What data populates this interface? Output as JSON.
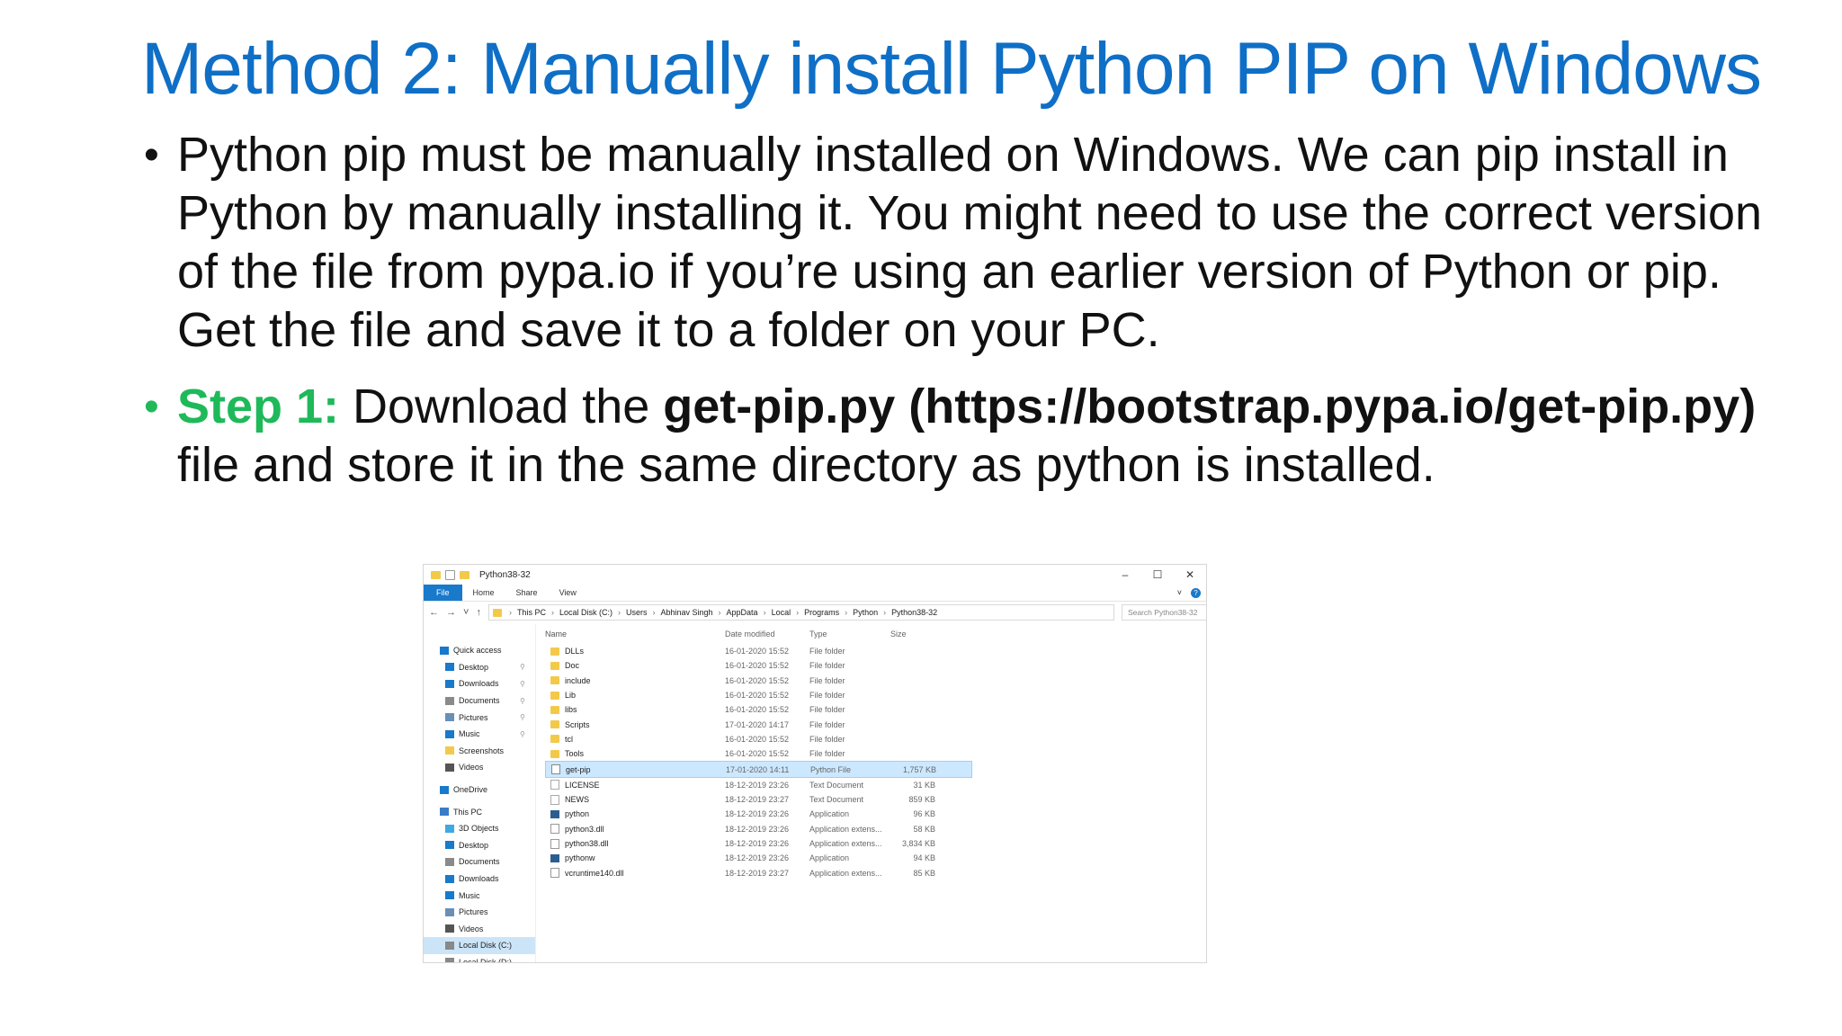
{
  "slide": {
    "title": "Method 2: Manually install Python PIP on Windows",
    "bullet1": "Python pip must be manually installed on Windows. We can pip install in Python by manually installing it. You might need to use the correct version of the file from pypa.io if you’re using an earlier version of Python or pip. Get the file and save it to a folder on your PC.",
    "bullet2": {
      "step_label": "Step 1:",
      "text1": " Download the ",
      "bold_link": "get-pip.py (https://bootstrap.pypa.io/get-pip.py)",
      "text2": " file and store it in the same directory as python is installed."
    },
    "bullet_char": "•"
  },
  "explorer": {
    "window_title": "Python38-32",
    "controls": {
      "minimize": "–",
      "maximize": "☐",
      "close": "✕"
    },
    "ribbon_tabs": [
      "File",
      "Home",
      "Share",
      "View"
    ],
    "nav_buttons": {
      "back": "←",
      "forward": "→",
      "dropdown": "˅",
      "up": "↑"
    },
    "breadcrumb": [
      "This PC",
      "Local Disk (C:)",
      "Users",
      "Abhinav Singh",
      "AppData",
      "Local",
      "Programs",
      "Python",
      "Python38-32"
    ],
    "search_placeholder": "Search Python38-32",
    "columns": {
      "name": "Name",
      "date": "Date modified",
      "type": "Type",
      "size": "Size"
    },
    "nav_pane": [
      {
        "label": "Quick access",
        "kind": "group",
        "color": "#1979ca"
      },
      {
        "label": "Desktop",
        "kind": "sub",
        "color": "#1979ca",
        "pinned": true
      },
      {
        "label": "Downloads",
        "kind": "sub",
        "color": "#1979ca",
        "pinned": true
      },
      {
        "label": "Documents",
        "kind": "sub",
        "color": "#8a8a8a",
        "pinned": true
      },
      {
        "label": "Pictures",
        "kind": "sub",
        "color": "#6a8fb5",
        "pinned": true
      },
      {
        "label": "Music",
        "kind": "sub",
        "color": "#1979ca",
        "pinned": true
      },
      {
        "label": "Screenshots",
        "kind": "sub",
        "color": "#f3c94a",
        "pinned": false
      },
      {
        "label": "Videos",
        "kind": "sub",
        "color": "#555555",
        "pinned": false
      },
      {
        "label": "OneDrive",
        "kind": "group",
        "color": "#1979ca"
      },
      {
        "label": "This PC",
        "kind": "group",
        "color": "#3a7bc8"
      },
      {
        "label": "3D Objects",
        "kind": "sub",
        "color": "#3fa9e0",
        "pinned": false
      },
      {
        "label": "Desktop",
        "kind": "sub",
        "color": "#1979ca",
        "pinned": false
      },
      {
        "label": "Documents",
        "kind": "sub",
        "color": "#8a8a8a",
        "pinned": false
      },
      {
        "label": "Downloads",
        "kind": "sub",
        "color": "#1979ca",
        "pinned": false
      },
      {
        "label": "Music",
        "kind": "sub",
        "color": "#1979ca",
        "pinned": false
      },
      {
        "label": "Pictures",
        "kind": "sub",
        "color": "#6a8fb5",
        "pinned": false
      },
      {
        "label": "Videos",
        "kind": "sub",
        "color": "#555555",
        "pinned": false
      },
      {
        "label": "Local Disk (C:)",
        "kind": "sub",
        "color": "#888888",
        "pinned": false,
        "selected": true
      },
      {
        "label": "Local Disk (D:)",
        "kind": "sub",
        "color": "#888888",
        "pinned": false
      }
    ],
    "files": [
      {
        "name": "DLLs",
        "date": "16-01-2020 15:52",
        "type": "File folder",
        "size": "",
        "icon": "folder"
      },
      {
        "name": "Doc",
        "date": "16-01-2020 15:52",
        "type": "File folder",
        "size": "",
        "icon": "folder"
      },
      {
        "name": "include",
        "date": "16-01-2020 15:52",
        "type": "File folder",
        "size": "",
        "icon": "folder"
      },
      {
        "name": "Lib",
        "date": "16-01-2020 15:52",
        "type": "File folder",
        "size": "",
        "icon": "folder"
      },
      {
        "name": "libs",
        "date": "16-01-2020 15:52",
        "type": "File folder",
        "size": "",
        "icon": "folder"
      },
      {
        "name": "Scripts",
        "date": "17-01-2020 14:17",
        "type": "File folder",
        "size": "",
        "icon": "folder"
      },
      {
        "name": "tcl",
        "date": "16-01-2020 15:52",
        "type": "File folder",
        "size": "",
        "icon": "folder"
      },
      {
        "name": "Tools",
        "date": "16-01-2020 15:52",
        "type": "File folder",
        "size": "",
        "icon": "folder"
      },
      {
        "name": "get-pip",
        "date": "17-01-2020 14:11",
        "type": "Python File",
        "size": "1,757 KB",
        "icon": "python",
        "selected": true
      },
      {
        "name": "LICENSE",
        "date": "18-12-2019 23:26",
        "type": "Text Document",
        "size": "31 KB",
        "icon": "text"
      },
      {
        "name": "NEWS",
        "date": "18-12-2019 23:27",
        "type": "Text Document",
        "size": "859 KB",
        "icon": "text"
      },
      {
        "name": "python",
        "date": "18-12-2019 23:26",
        "type": "Application",
        "size": "96 KB",
        "icon": "app"
      },
      {
        "name": "python3.dll",
        "date": "18-12-2019 23:26",
        "type": "Application extens...",
        "size": "58 KB",
        "icon": "dll"
      },
      {
        "name": "python38.dll",
        "date": "18-12-2019 23:26",
        "type": "Application extens...",
        "size": "3,834 KB",
        "icon": "dll"
      },
      {
        "name": "pythonw",
        "date": "18-12-2019 23:26",
        "type": "Application",
        "size": "94 KB",
        "icon": "app"
      },
      {
        "name": "vcruntime140.dll",
        "date": "18-12-2019 23:27",
        "type": "Application extens...",
        "size": "85 KB",
        "icon": "dll"
      }
    ]
  }
}
